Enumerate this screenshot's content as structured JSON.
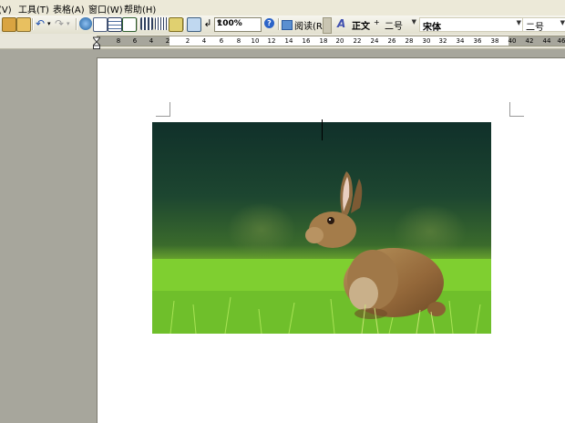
{
  "menu": [
    {
      "label": "视图(V)"
    },
    {
      "label": "工具(T)"
    },
    {
      "label": "表格(A)"
    },
    {
      "label": "窗口(W)"
    },
    {
      "label": "帮助(H)"
    }
  ],
  "toolbar": {
    "zoom": "100%",
    "read_label": "阅读(R)",
    "style": "正文",
    "style_size": "二号",
    "font": "宋体",
    "font_size": "二号",
    "icons": [
      "paste-icon",
      "format-painter-icon",
      "undo-icon",
      "redo-icon",
      "hyperlink-icon",
      "tables-borders-icon",
      "insert-table-icon",
      "insert-excel-icon",
      "columns-icon",
      "drawing-icon",
      "document-map-icon",
      "show-hide-icon",
      "help-icon",
      "styles-icon"
    ]
  },
  "ruler": {
    "left_ticks": [
      "8",
      "6",
      "4",
      "2"
    ],
    "right_ticks": [
      "2",
      "4",
      "6",
      "8",
      "10",
      "12",
      "14",
      "16",
      "18",
      "20",
      "22",
      "24",
      "26",
      "28",
      "30",
      "32",
      "34",
      "36",
      "38",
      "40",
      "42",
      "44",
      "46"
    ]
  },
  "document": {
    "image": "rabbit-photo",
    "colors": {
      "sky": "#1a3a2a",
      "grass": "#8fd030",
      "rabbit": "#a67a45"
    }
  }
}
